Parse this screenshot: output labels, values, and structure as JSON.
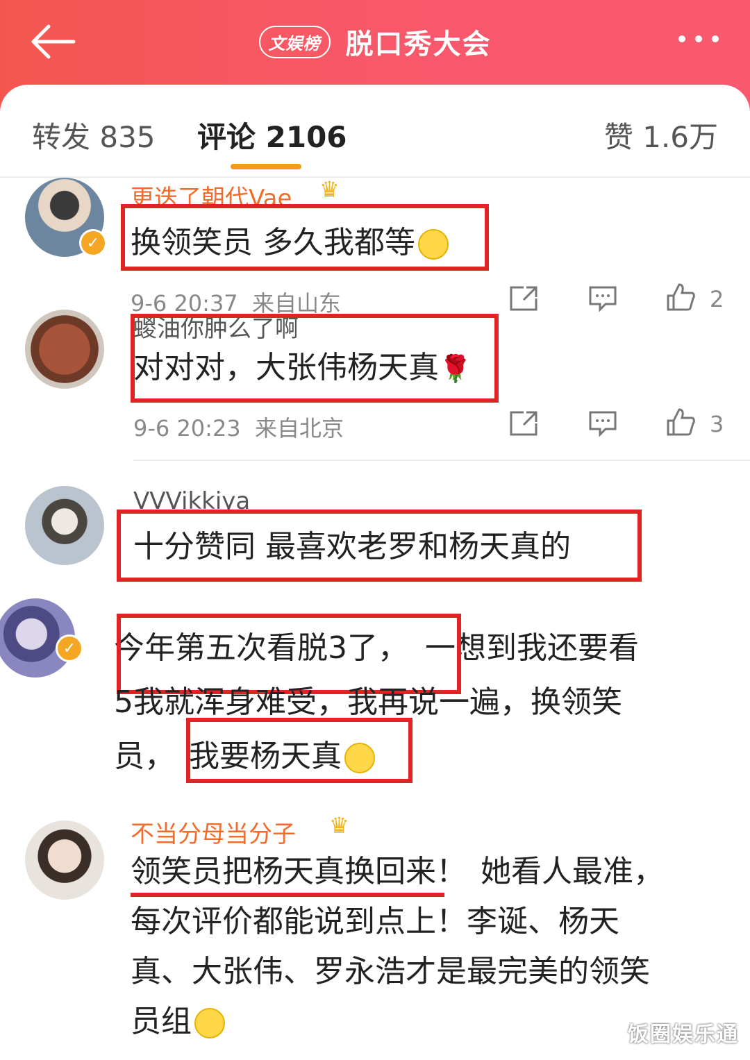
{
  "header": {
    "badge": "文娱榜",
    "title": "脱口秀大会"
  },
  "tabs": {
    "repost": "转发 835",
    "comment": "评论 2106",
    "like": "赞 1.6万"
  },
  "comments": [
    {
      "username": "更迭了朝代Vae",
      "text": "换领笑员 多久我都等",
      "time": "9-6 20:37",
      "location": "来自山东",
      "likes": "2"
    },
    {
      "username": "蝬油你肿么了啊",
      "text": "对对对，大张伟杨天真",
      "time": "9-6 20:23",
      "location": "来自北京",
      "likes": "3"
    },
    {
      "username": "VVVikkiya",
      "text": "十分赞同 最喜欢老罗和杨天真的"
    },
    {
      "line1a": "今年第五次看脱3了，",
      "line1b": "一想到我还要看",
      "line2": "5我就浑身难受，我再说一遍，换领笑",
      "line3a": "员，",
      "line3b": "我要杨天真"
    },
    {
      "username": "不当分母当分子",
      "line1a": "领笑员把杨天真换回来！",
      "line1b": "她看人最准，",
      "line2": "每次评价都能说到点上！李诞、杨天",
      "line3": "真、大张伟、罗永浩才是最完美的领笑",
      "line4": "员组"
    }
  ],
  "watermark": "饭圈娱乐通",
  "colors": {
    "header": "#f4564f",
    "tab_underline": "#f39a1d",
    "username": "#f26b2a",
    "highlight": "#e02424"
  }
}
